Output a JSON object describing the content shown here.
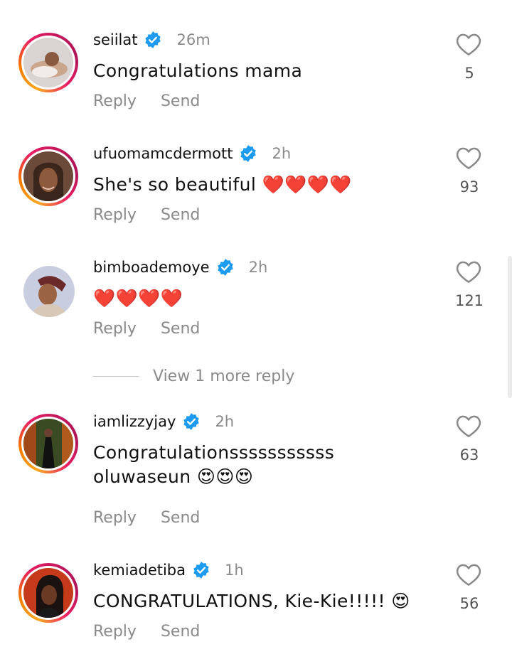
{
  "comments": [
    {
      "username": "seiilat",
      "time": "26m",
      "text": "Congratulations mama",
      "likes": "5",
      "reply_label": "Reply",
      "send_label": "Send",
      "story_ring": true,
      "verified": true
    },
    {
      "username": "ufuomamcdermott",
      "time": "2h",
      "text": "She's so beautiful ❤️❤️❤️❤️",
      "likes": "93",
      "reply_label": "Reply",
      "send_label": "Send",
      "story_ring": true,
      "verified": true
    },
    {
      "username": "bimboademoye",
      "time": "2h",
      "text": "❤️❤️❤️❤️",
      "likes": "121",
      "reply_label": "Reply",
      "send_label": "Send",
      "story_ring": false,
      "verified": true
    },
    {
      "username": "iamlizzyjay",
      "time": "2h",
      "text": "Congratulationsssssssssss oluwaseun 😍😍😍",
      "likes": "63",
      "reply_label": "Reply",
      "send_label": "Send",
      "story_ring": true,
      "verified": true
    },
    {
      "username": "kemiadetiba",
      "time": "1h",
      "text": "CONGRATULATIONS, Kie-Kie!!!!! 😍",
      "likes": "56",
      "reply_label": "Reply",
      "send_label": "Send",
      "story_ring": true,
      "verified": true
    }
  ],
  "view_more_replies": "View 1 more reply",
  "colors": {
    "verified_badge": "#1d9bf0",
    "secondary_text": "#8a8a8a",
    "story_ring_start": "#f9a825",
    "story_ring_end": "#c2185b"
  },
  "icons": {
    "verified": "verified-badge-icon",
    "like": "heart-outline-icon"
  }
}
